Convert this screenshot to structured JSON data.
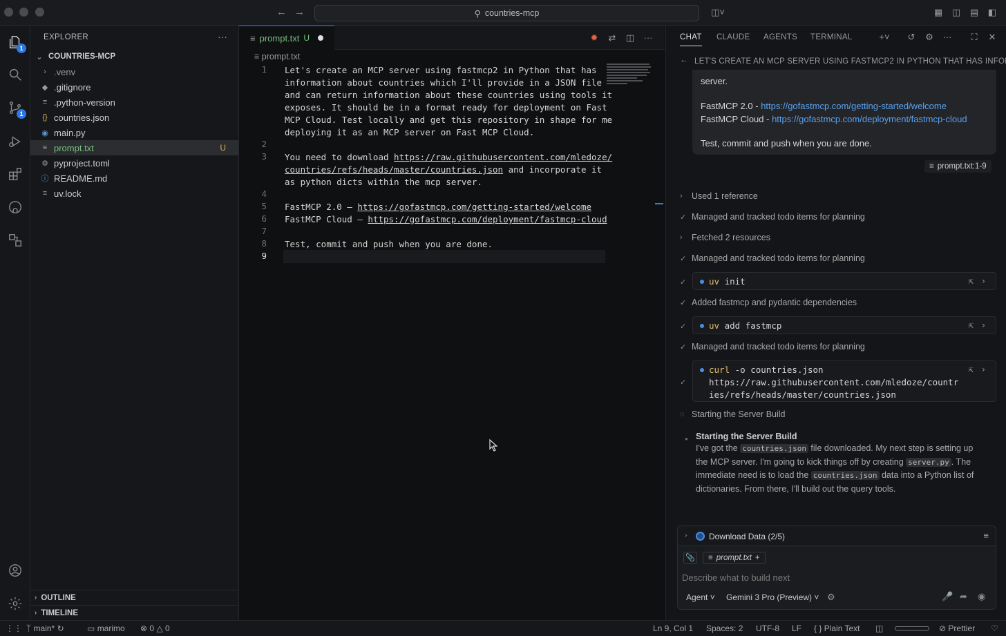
{
  "titlebar": {
    "search_text": "countries-mcp"
  },
  "activitybar": {
    "explorer_badge": "1",
    "scm_badge": "1"
  },
  "explorer": {
    "title": "EXPLORER",
    "root": "COUNTRIES-MCP",
    "items": [
      {
        "label": ".venv",
        "icon": "chevron-right-icon",
        "kind": "folder"
      },
      {
        "label": ".gitignore",
        "icon": "gitignore-icon",
        "kind": "file"
      },
      {
        "label": ".python-version",
        "icon": "text-file-icon",
        "kind": "file"
      },
      {
        "label": "countries.json",
        "icon": "json-icon",
        "kind": "file"
      },
      {
        "label": "main.py",
        "icon": "python-icon",
        "kind": "file"
      },
      {
        "label": "prompt.txt",
        "icon": "text-file-icon",
        "kind": "file",
        "status": "U"
      },
      {
        "label": "pyproject.toml",
        "icon": "gear-icon",
        "kind": "file"
      },
      {
        "label": "README.md",
        "icon": "info-icon",
        "kind": "file"
      },
      {
        "label": "uv.lock",
        "icon": "text-file-icon",
        "kind": "file"
      }
    ],
    "outline": "OUTLINE",
    "timeline": "TIMELINE"
  },
  "editor": {
    "tab_label": "prompt.txt",
    "tab_status": "U",
    "breadcrumb": "prompt.txt",
    "lines": [
      {
        "n": "1",
        "rows": [
          "Let's create an MCP server using fastmcp2 in Python that has",
          "information about countries which I'll provide in a JSON file",
          "and can return information about these countries using tools it",
          "exposes. It should be in a format ready for deployment on Fast",
          "MCP Cloud. Test locally and get this repository in shape for me",
          "deploying it as an MCP server on Fast MCP Cloud."
        ]
      },
      {
        "n": "2",
        "rows": [
          ""
        ]
      },
      {
        "n": "3",
        "rows": [
          "You need to download https://raw.githubusercontent.com/mledoze/",
          "countries/refs/heads/master/countries.json and incorporate it",
          "as python dicts within the mcp server."
        ]
      },
      {
        "n": "4",
        "rows": [
          ""
        ]
      },
      {
        "n": "5",
        "rows": [
          "FastMCP 2.0 – https://gofastmcp.com/getting-started/welcome"
        ]
      },
      {
        "n": "6",
        "rows": [
          "FastMCP Cloud – https://gofastmcp.com/deployment/fastmcp-cloud"
        ]
      },
      {
        "n": "7",
        "rows": [
          ""
        ]
      },
      {
        "n": "8",
        "rows": [
          "Test, commit and push when you are done."
        ]
      },
      {
        "n": "9",
        "rows": [
          ""
        ]
      }
    ]
  },
  "chat": {
    "tabs": [
      "CHAT",
      "CLAUDE",
      "AGENTS",
      "TERMINAL"
    ],
    "header": "LET'S CREATE AN MCP SERVER USING FASTMCP2 IN PYTHON THAT HAS INFOR...",
    "user_message": {
      "line0": "server.",
      "fastmcp_label": "FastMCP 2.0 - ",
      "fastmcp_url": "https://gofastmcp.com/getting-started/welcome",
      "cloud_label": "FastMCP Cloud - ",
      "cloud_url": "https://gofastmcp.com/deployment/fastmcp-cloud",
      "closing": "Test, commit and push when you are done.",
      "ref": "prompt.txt:1-9"
    },
    "steps": [
      {
        "label": "Used 1 reference",
        "mark": "chevron"
      },
      {
        "label": "Managed and tracked todo items for planning",
        "mark": "check"
      },
      {
        "label": "Fetched 2 resources",
        "mark": "chevron"
      },
      {
        "label": "Managed and tracked todo items for planning",
        "mark": "check"
      },
      {
        "label": "Added fastmcp and pydantic dependencies",
        "mark": "check"
      },
      {
        "label": "Managed and tracked todo items for planning",
        "mark": "check"
      },
      {
        "label": "Starting the Server Build",
        "mark": "spinner"
      }
    ],
    "commands": [
      {
        "kw": "uv",
        "rest": " init"
      },
      {
        "kw": "uv",
        "rest": " add fastmcp"
      },
      {
        "kw": "curl",
        "rest": " -o countries.json",
        "line2": "https://raw.githubusercontent.com/mledoze/countr",
        "line3": "ies/refs/heads/master/countries.json"
      }
    ],
    "thinking": {
      "title": "Starting the Server Build",
      "t1": "I've got the ",
      "c1": "countries.json",
      "t2": " file downloaded. My next step is setting up the MCP server. I'm going to kick things off by creating ",
      "c2": "server.py",
      "t3": ". The immediate need is to load the ",
      "c3": "countries.json",
      "t4": " data into a Python list of dictionaries. From there, I'll build out the query tools."
    },
    "todo": "Download Data (2/5)",
    "input": {
      "context_file": "prompt.txt",
      "placeholder": "Describe what to build next",
      "mode": "Agent",
      "model": "Gemini 3 Pro (Preview)"
    }
  },
  "statusbar": {
    "branch": "main*",
    "env": "marimo",
    "errors": "0",
    "warnings": "0",
    "position": "Ln 9, Col 1",
    "spaces": "Spaces: 2",
    "encoding": "UTF-8",
    "eol": "LF",
    "language": "Plain Text",
    "formatter": "Prettier"
  },
  "colors": {
    "accent": "#2b78e4",
    "untracked": "#74c07a",
    "link": "#5aa2f0"
  }
}
